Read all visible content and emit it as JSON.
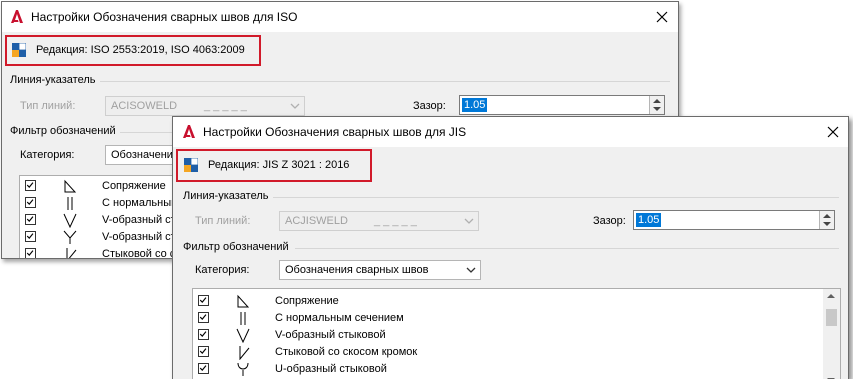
{
  "iso_dialog": {
    "title": "Настройки Обозначения сварных швов для ISO",
    "edition": "Редакция: ISO 2553:2019, ISO 4063:2009",
    "leader_group": "Линия-указатель",
    "linetype_label": "Тип линий:",
    "linetype_value": "ACISOWELD",
    "linetype_dashes": "_ _ _ _ _",
    "gap_label": "Зазор:",
    "gap_value": "1.05",
    "filter_group": "Фильтр обозначений",
    "category_label": "Категория:",
    "category_value": "Обозначения сварных швов",
    "category_visible_text": "Обозначения",
    "items": [
      {
        "symbol": "fillet-symbol-icon",
        "label": "Сопряжение",
        "checked": true
      },
      {
        "symbol": "square-butt-symbol-icon",
        "label": "С нормальным сечением",
        "visible_label": "С нормальным",
        "checked": true
      },
      {
        "symbol": "v-butt-symbol-icon",
        "label": "V-образный стыковой",
        "visible_label": "V-образный сты",
        "checked": true
      },
      {
        "symbol": "y-butt-symbol-icon",
        "label": "V-образный стыковой",
        "visible_label": "V-образный сты",
        "checked": true
      },
      {
        "symbol": "bevel-butt-symbol-icon",
        "label": "Стыковой со скосом кромок",
        "visible_label": "Стыковой со ск",
        "checked": true
      }
    ]
  },
  "jis_dialog": {
    "title": "Настройки Обозначения сварных швов для JIS",
    "edition": "Редакция: JIS Z 3021 : 2016",
    "leader_group": "Линия-указатель",
    "linetype_label": "Тип линий:",
    "linetype_value": "ACJISWELD",
    "linetype_dashes": "_ _ _ _ _",
    "gap_label": "Зазор:",
    "gap_value": "1.05",
    "filter_group": "Фильтр обозначений",
    "category_label": "Категория:",
    "category_value": "Обозначения сварных швов",
    "items": [
      {
        "symbol": "fillet-symbol-icon",
        "label": "Сопряжение",
        "checked": true
      },
      {
        "symbol": "square-butt-symbol-icon",
        "label": "С нормальным сечением",
        "checked": true
      },
      {
        "symbol": "v-butt-symbol-icon",
        "label": "V-образный стыковой",
        "checked": true
      },
      {
        "symbol": "bevel-butt-symbol-icon",
        "label": "Стыковой со скосом кромок",
        "checked": true
      },
      {
        "symbol": "u-butt-symbol-icon",
        "label": "U-образный стыковой",
        "checked": true
      }
    ]
  },
  "colors": {
    "highlight_box": "#d11a2a",
    "app_logo": "#c8102e",
    "selection": "#0078d7",
    "dialog_bg": "#f0f0f0"
  }
}
